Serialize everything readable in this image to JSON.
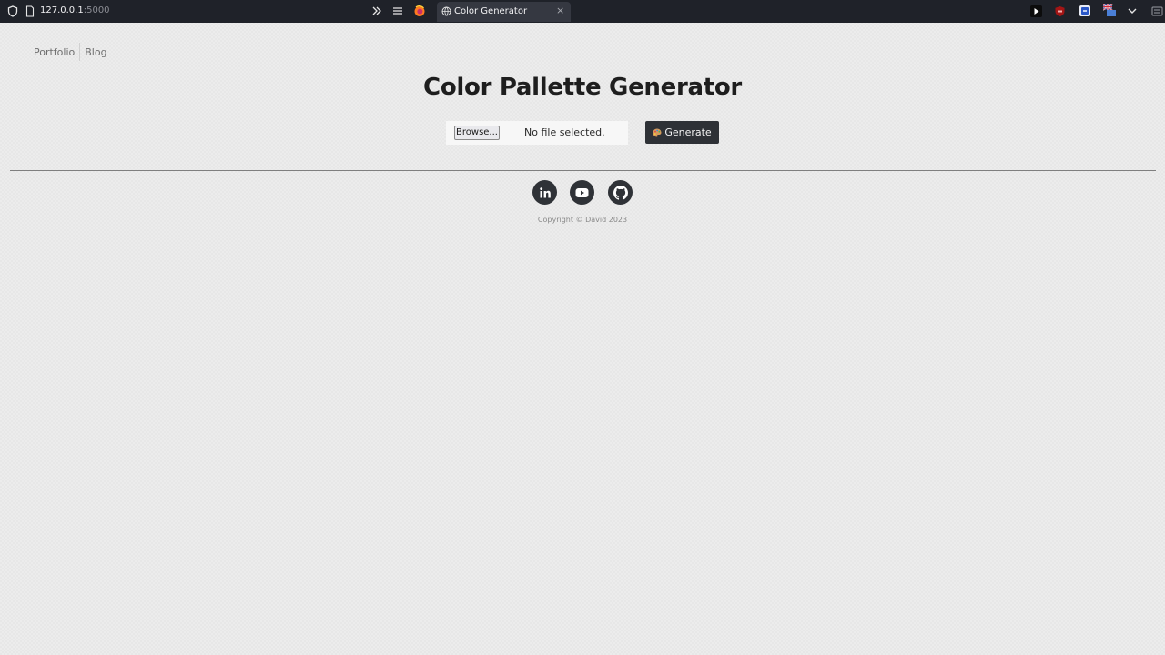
{
  "browser": {
    "url_host": "127.0.0.1",
    "url_port": ":5000",
    "tab_title": "Color Generator",
    "tab_close": "×"
  },
  "nav": {
    "items": [
      {
        "label": "Portfolio"
      },
      {
        "label": "Blog"
      }
    ]
  },
  "page": {
    "title": "Color Pallette Generator"
  },
  "upload": {
    "browse_label": "Browse...",
    "status": "No file selected."
  },
  "generate": {
    "label": "Generate"
  },
  "footer": {
    "social": [
      {
        "name": "LinkedIn",
        "icon": "linkedin-icon"
      },
      {
        "name": "YouTube",
        "icon": "youtube-icon"
      },
      {
        "name": "GitHub",
        "icon": "github-icon"
      }
    ],
    "copyright": "Copyright © David 2023"
  },
  "colors": {
    "chrome_bg": "#1f2229",
    "tab_bg": "#353841",
    "page_bg": "#ececec",
    "button_bg": "#2e3136",
    "title_text": "#1e1e1e"
  }
}
